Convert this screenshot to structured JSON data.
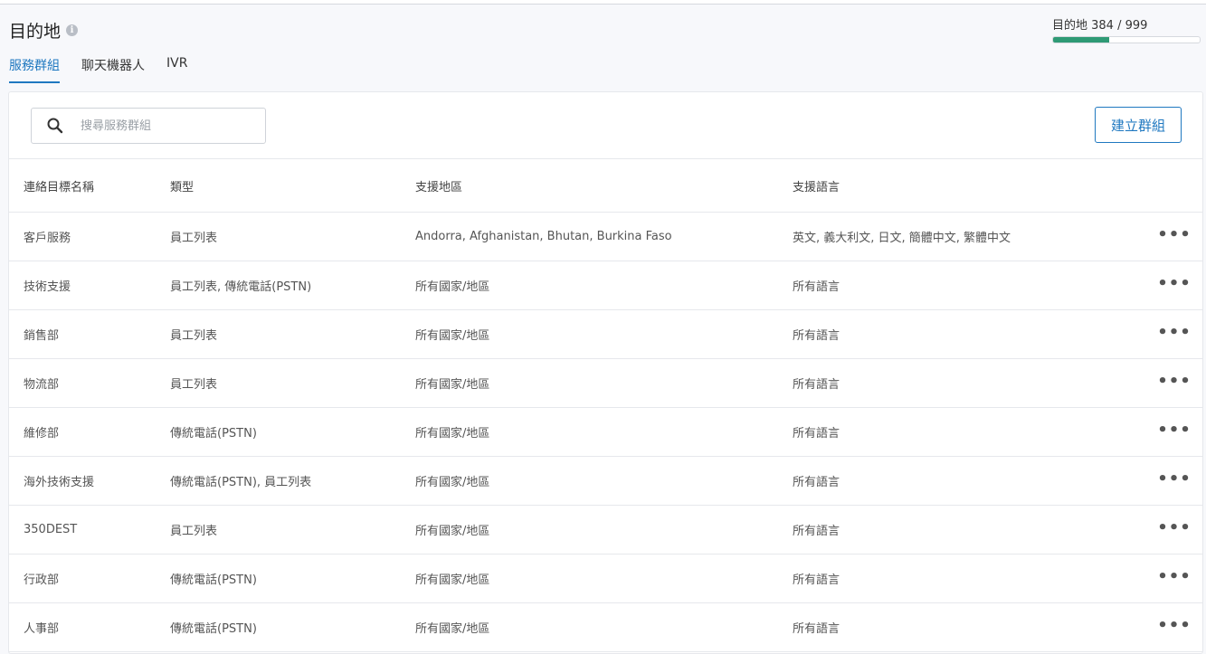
{
  "header": {
    "title": "目的地",
    "quota_label": "目的地 384 / 999",
    "quota_used": 384,
    "quota_max": 999
  },
  "tabs": [
    {
      "label": "服務群組",
      "active": true
    },
    {
      "label": "聊天機器人",
      "active": false
    },
    {
      "label": "IVR",
      "active": false
    }
  ],
  "search": {
    "placeholder": "搜尋服務群組"
  },
  "toolbar": {
    "create_label": "建立群組"
  },
  "table": {
    "headers": [
      "連絡目標名稱",
      "類型",
      "支援地區",
      "支援語言"
    ],
    "rows": [
      {
        "name": "客戶服務",
        "type": "員工列表",
        "region": "Andorra, Afghanistan, Bhutan, Burkina Faso",
        "language": "英文, 義大利文, 日文, 簡體中文, 繁體中文"
      },
      {
        "name": "技術支援",
        "type": "員工列表, 傳統電話(PSTN)",
        "region": "所有國家/地區",
        "language": "所有語言"
      },
      {
        "name": "銷售部",
        "type": "員工列表",
        "region": "所有國家/地區",
        "language": "所有語言"
      },
      {
        "name": "物流部",
        "type": "員工列表",
        "region": "所有國家/地區",
        "language": "所有語言"
      },
      {
        "name": "維修部",
        "type": "傳統電話(PSTN)",
        "region": "所有國家/地區",
        "language": "所有語言"
      },
      {
        "name": "海外技術支援",
        "type": "傳統電話(PSTN), 員工列表",
        "region": "所有國家/地區",
        "language": "所有語言"
      },
      {
        "name": "350DEST",
        "type": "員工列表",
        "region": "所有國家/地區",
        "language": "所有語言"
      },
      {
        "name": "行政部",
        "type": "傳統電話(PSTN)",
        "region": "所有國家/地區",
        "language": "所有語言"
      },
      {
        "name": "人事部",
        "type": "傳統電話(PSTN)",
        "region": "所有國家/地區",
        "language": "所有語言"
      }
    ]
  },
  "colors": {
    "accent": "#1f78c0",
    "progress": "#2e9a75"
  },
  "icons": {
    "info": "info-icon",
    "search": "search-icon",
    "row_action": "more-icon"
  }
}
